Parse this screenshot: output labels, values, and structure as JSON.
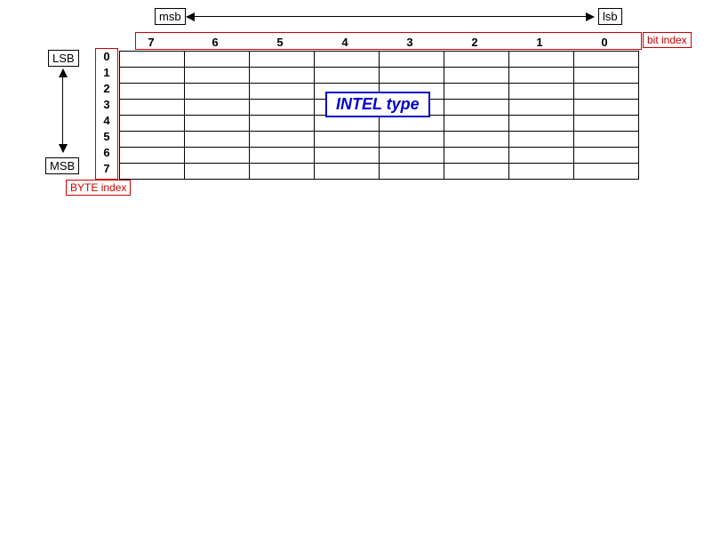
{
  "top": {
    "msb": "msb",
    "lsb": "lsb",
    "bit_index_label": "bit index",
    "cols": [
      "7",
      "6",
      "5",
      "4",
      "3",
      "2",
      "1",
      "0"
    ]
  },
  "left": {
    "lsb": "LSB",
    "msb": "MSB",
    "rows": [
      "0",
      "1",
      "2",
      "3",
      "4",
      "5",
      "6",
      "7"
    ],
    "byte_index_label": "BYTE index"
  },
  "title": "INTEL type"
}
